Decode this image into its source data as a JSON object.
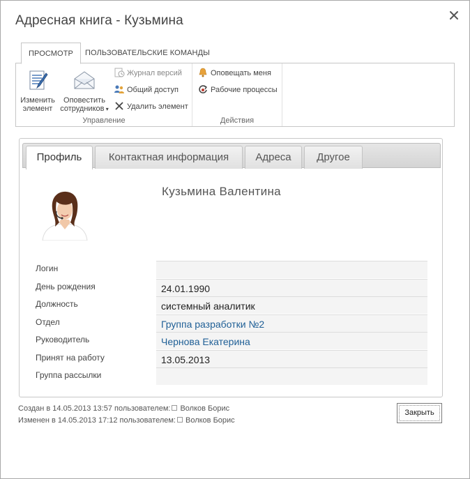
{
  "dialog": {
    "title": "Адресная книга - Кузьмина"
  },
  "ribbon": {
    "tabs": [
      {
        "label": "ПРОСМОТР",
        "active": true
      },
      {
        "label": "ПОЛЬЗОВАТЕЛЬСКИЕ КОМАНДЫ",
        "active": false
      }
    ],
    "groups": {
      "manage": {
        "label": "Управление",
        "edit_line1": "Изменить",
        "edit_line2": "элемент",
        "notify_line1": "Оповестить",
        "notify_line2": "сотрудников",
        "history": "Журнал версий",
        "share": "Общий доступ",
        "delete": "Удалить элемент"
      },
      "actions": {
        "label": "Действия",
        "alert_me": "Оповещать меня",
        "workflows": "Рабочие процессы"
      }
    }
  },
  "profile_tabs": [
    {
      "label": "Профиль",
      "active": true
    },
    {
      "label": "Контактная информация",
      "active": false
    },
    {
      "label": "Адреса",
      "active": false
    },
    {
      "label": "Другое",
      "active": false
    }
  ],
  "person": {
    "name": "Кузьмина Валентина"
  },
  "fields": [
    {
      "label": "Логин",
      "value": ""
    },
    {
      "label": "День рождения",
      "value": "24.01.1990"
    },
    {
      "label": "Должность",
      "value": "системный аналитик"
    },
    {
      "label": "Отдел",
      "value": "Группа разработки №2",
      "link": true
    },
    {
      "label": "Руководитель",
      "value": "Чернова Екатерина",
      "link": true
    },
    {
      "label": "Принят на работу",
      "value": "13.05.2013"
    },
    {
      "label": "Группа рассылки",
      "value": ""
    }
  ],
  "footer": {
    "created_prefix": "Создан в 14.05.2013 13:57 пользователем:",
    "created_user": "Волков Борис",
    "modified_prefix": "Изменен в 14.05.2013 17:12 пользователем:",
    "modified_user": "Волков Борис",
    "close_label": "Закрыть"
  },
  "colors": {
    "link": "#1f5f96",
    "field_bg": "#f4f4f4"
  }
}
